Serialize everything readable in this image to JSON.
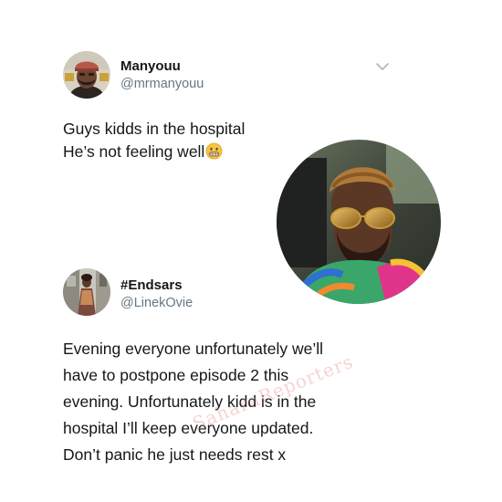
{
  "tweet1": {
    "display_name": "Manyouu",
    "handle": "@mrmanyouu",
    "text_lines": [
      "Guys kidds in the hospital",
      "He’s not feeling well"
    ],
    "emoji": "grimacing-face",
    "menu_icon": "chevron-down-icon"
  },
  "tweet2": {
    "display_name": "#Endsars",
    "handle": "@LinekOvie",
    "text_lines": [
      "Evening everyone unfortunately we’ll",
      "have to postpone episode 2 this",
      "evening. Unfortunately kidd is in the",
      "hospital I’ll keep everyone updated.",
      "Don’t panic he just needs rest x"
    ]
  },
  "watermark": "SaharaReporters",
  "colors": {
    "text": "#14171a",
    "handle": "#657786",
    "chevron": "#aab8c2",
    "watermark": "#e78c8c"
  }
}
